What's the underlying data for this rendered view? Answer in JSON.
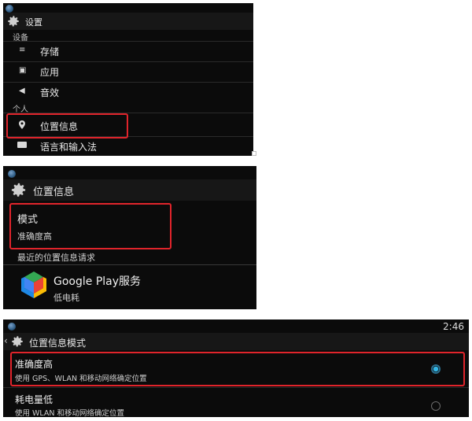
{
  "panel1": {
    "title": "设置",
    "section_device": "设备",
    "section_personal": "个人",
    "items": [
      {
        "label": "存储",
        "icon": "storage-icon"
      },
      {
        "label": "应用",
        "icon": "apps-icon"
      },
      {
        "label": "音效",
        "icon": "sound-icon"
      },
      {
        "label": "位置信息",
        "icon": "location-pin-icon"
      },
      {
        "label": "语言和输入法",
        "icon": "keyboard-icon"
      }
    ]
  },
  "panel2": {
    "title": "位置信息",
    "mode_label": "模式",
    "mode_value": "准确度高",
    "recent_header": "最近的位置信息请求",
    "app_name": "Google Play服务",
    "app_usage": "低电耗"
  },
  "panel3": {
    "time": "2:46",
    "title": "位置信息模式",
    "options": [
      {
        "label": "准确度高",
        "desc": "使用 GPS、WLAN 和移动网络确定位置",
        "selected": true
      },
      {
        "label": "耗电量低",
        "desc": "使用 WLAN 和移动网络确定位置",
        "selected": false
      }
    ]
  },
  "colors": {
    "highlight": "#e0242b",
    "accent": "#33b5e5",
    "background": "#0b0b0b"
  }
}
